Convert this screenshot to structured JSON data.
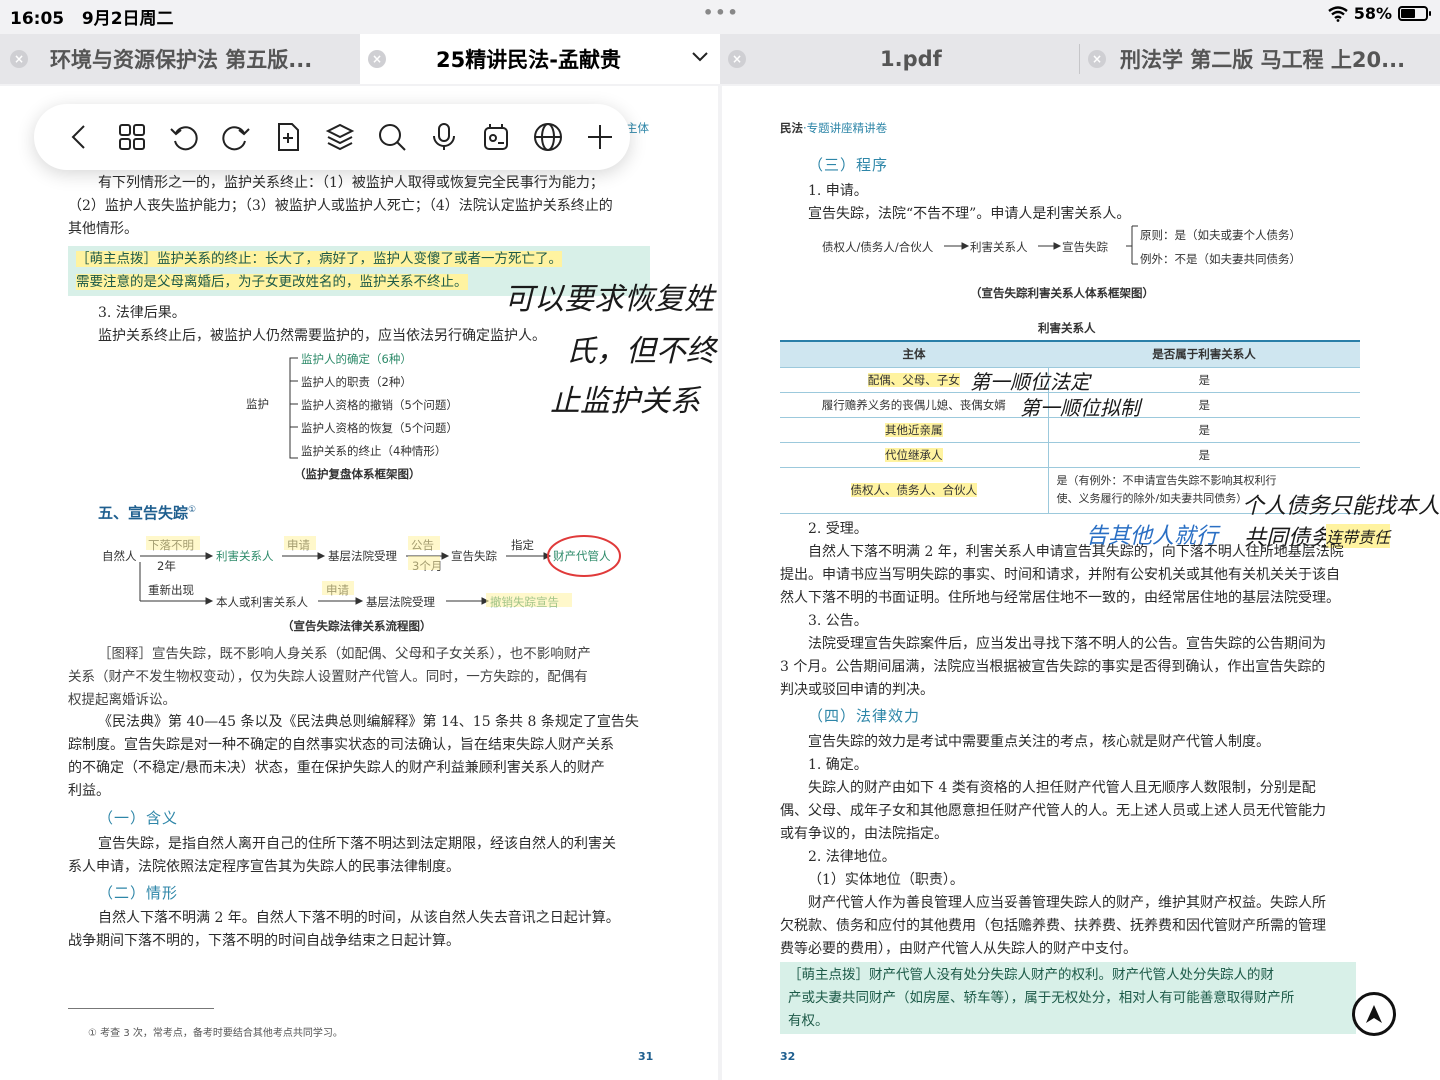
{
  "status_bar": {
    "time": "16:05",
    "date": "9月2日周二",
    "battery_text": "58%",
    "battery_level": 0.58,
    "dots": "•••"
  },
  "tabs": [
    {
      "title": "环境与资源保护法 第五版...",
      "active": false
    },
    {
      "title": "25精讲民法-孟献贵",
      "active": true
    },
    {
      "title": "1.pdf",
      "active": false
    },
    {
      "title": "刑法学 第二版 马工程 上20...",
      "active": false
    }
  ],
  "toolbar": {
    "icons": [
      "back-icon",
      "grid-icon",
      "undo-icon",
      "redo-icon",
      "add-page-icon",
      "layers-icon",
      "search-icon",
      "microphone-icon",
      "sticker-icon",
      "globe-icon",
      "plus-icon"
    ],
    "peek_text": "主体"
  },
  "left_page": {
    "p1": "有下列情形之一的，监护关系终止：（1）被监护人取得或恢复完全民事行为能力；",
    "p2": "（2）监护人丧失监护能力；（3）被监护人或监护人死亡；（4）法院认定监护关系终止的",
    "p3": "其他情形。",
    "tip1": "［萌主点拨］监护关系的终止：长大了，病好了，监护人变傻了或者一方死亡了。",
    "tip2": "需要注意的是父母离婚后，为子女更改姓名的，监护关系不终止。",
    "hand1": "可以要求恢复姓",
    "hand2": "氏，但不终",
    "hand3": "止监护关系",
    "item3": "3. 法律后果。",
    "p4": "监护关系终止后，被监护人仍然需要监护的，应当依法另行确定监护人。",
    "tree_root": "监护",
    "tree_items": [
      "监护人的确定（6种）",
      "监护人的职责（2种）",
      "监护人资格的撤销（5个问题）",
      "监护人资格的恢复（5个问题）",
      "监护关系的终止（4种情形）"
    ],
    "tree_caption": "（监护复盘体系框架图）",
    "section5": "五、宣告失踪",
    "section5_note": "①",
    "flow": {
      "natural_person": "自然人",
      "missing": "下落不明",
      "two_years": "2年",
      "interested": "利害关系人",
      "apply": "申请",
      "court_accept": "基层法院受理",
      "announce": "公告",
      "three_months": "3个月",
      "declare": "宣告失踪",
      "appoint": "指定",
      "custodian": "财产代管人",
      "reappear": "重新出现",
      "self_or_interested": "本人或利害关系人",
      "apply2": "申请",
      "court_accept2": "基层法院受理",
      "revoke": "撤销失踪宣告",
      "caption": "（宣告失踪法律关系流程图）"
    },
    "fig1": "［图释］宣告失踪，既不影响人身关系（如配偶、父母和子女关系），也不影响财产",
    "fig2": "关系（财产不发生物权变动），仅为失踪人设置财产代管人。同时，一方失踪的，配偶有",
    "fig3": "权提起离婚诉讼。",
    "law1": "《民法典》第 40—45 条以及《民法典总则编解释》第 14、15 条共 8 条规定了宣告失",
    "law2": "踪制度。宣告失踪是对一种不确定的自然事实状态的司法确认，旨在结束失踪人财产关系",
    "law3": "的不确定（不稳定/悬而未决）状态，重在保护失踪人的财产利益兼顾利害关系人的财产",
    "law4": "利益。",
    "sub1": "（一）含义",
    "def1": "宣告失踪，是指自然人离开自己的住所下落不明达到法定期限，经该自然人的利害关",
    "def2": "系人申请，法院依照法定程序宣告其为失踪人的民事法律制度。",
    "sub2": "（二）情形",
    "sit1": "自然人下落不明满 2 年。自然人下落不明的时间，从该自然人失去音讯之日起计算。",
    "sit2": "战争期间下落不明的，下落不明的时间自战争结束之日起计算。",
    "footnote": "①  考查 3 次，常考点，备考时要结合其他考点共同学习。",
    "page_number": "31"
  },
  "right_page": {
    "running_head_a": "民法",
    "running_head_b": "·专题讲座精讲卷",
    "sub3": "（三）程序",
    "item1": "1. 申请。",
    "apply_text": "宣告失踪，法院“不告不理”。申请人是利害关系人。",
    "chain": "债权人/债务人/合伙人",
    "chain2": "利害关系人",
    "chain3": "宣告失踪",
    "rule": "原则：是（如夫或妻个人债务）",
    "exception": "例外：不是（如夫妻共同债务）",
    "caption1": "（宣告失踪利害关系人体系框架图）",
    "table_title": "利害关系人",
    "table_headers": [
      "主体",
      "是否属于利害关系人"
    ],
    "table_rows": [
      {
        "subject": "配偶、父母、子女",
        "answer": "是",
        "note": "第一顺位法定"
      },
      {
        "subject": "履行赡养义务的丧偶儿媳、丧偶女婿",
        "answer": "是",
        "note": "第一顺位拟制"
      },
      {
        "subject": "其他近亲属",
        "answer": "是",
        "note": ""
      },
      {
        "subject": "代位继承人",
        "answer": "是",
        "note": ""
      },
      {
        "subject": "债权人、债务人、合伙人",
        "answer": "是（有例外：不申请宣告失踪不影响其权利行使、义务履行的除外/如夫妻共同债务）",
        "note": ""
      }
    ],
    "hand_personal": "个人债务只能找本人",
    "hand_tell": "告其他人就行",
    "hand_joint": "共同债务",
    "hand_joint2": "连带责任",
    "item2": "2. 受理。",
    "acc1": "自然人下落不明满 2 年，利害关系人申请宣告其失踪的，向下落不明人住所地基层法院",
    "acc2": "提出。申请书应当写明失踪的事实、时间和请求，并附有公安机关或其他有关机关关于该自",
    "acc3": "然人下落不明的书面证明。住所地与经常居住地不一致的，由经常居住地的基层法院受理。",
    "item3": "3. 公告。",
    "ann1": "法院受理宣告失踪案件后，应当发出寻找下落不明人的公告。宣告失踪的公告期间为",
    "ann2": "3 个月。公告期间届满，法院应当根据被宣告失踪的事实是否得到确认，作出宣告失踪的",
    "ann3": "判决或驳回申请的判决。",
    "sub4": "（四）法律效力",
    "eff1": "宣告失踪的效力是考试中需要重点关注的考点，核心就是财产代管人制度。",
    "eff_item1": "1. 确定。",
    "det1": "失踪人的财产由如下 4 类有资格的人担任财产代管人且无顺序人数限制，分别是配",
    "det2": "偶、父母、成年子女和其他愿意担任财产代管人的人。无上述人员或上述人员无代管能力",
    "det3": "或有争议的，由法院指定。",
    "eff_item2": "2. 法律地位。",
    "pos1": "（1）实体地位（职责）。",
    "res1": "财产代管人作为善良管理人应当妥善管理失踪人的财产，维护其财产权益。失踪人所",
    "res2": "欠税款、债务和应付的其他费用（包括赡养费、扶养费、抚养费和因代管财产所需的管理",
    "res3": "费等必要的费用），由财产代管人从失踪人的财产中支付。",
    "tip1": "［萌主点拨］财产代管人没有处分失踪人财产的权利。财产代管人处分失踪人的财",
    "tip2": "产或夫妻共同财产（如房屋、轿车等），属于无权处分，相对人有可能善意取得财产所",
    "tip3": "有权。",
    "page_number": "32"
  },
  "nav_button": {
    "icon": "navigate-up-icon"
  }
}
